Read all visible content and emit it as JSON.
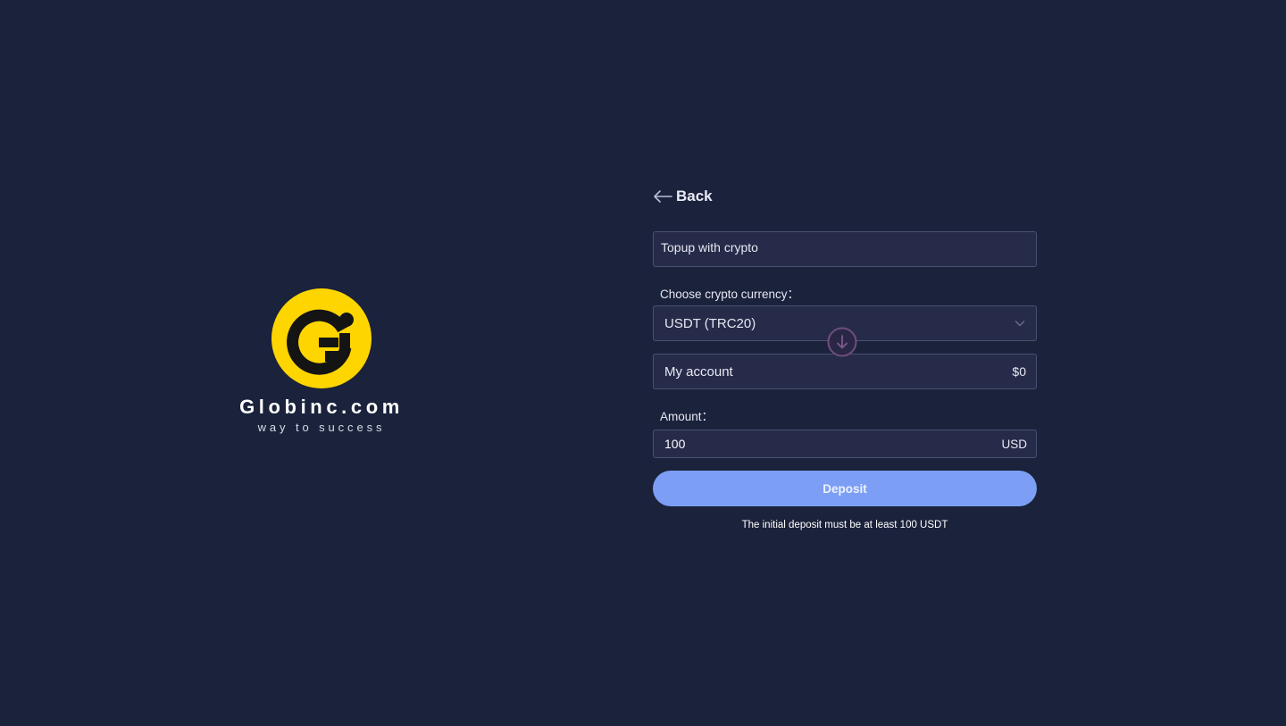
{
  "brand": {
    "name": "Globinc.com",
    "tagline": "way to success",
    "logo_color": "#ffd500"
  },
  "back": {
    "label": "Back",
    "icon": "arrow-left-icon"
  },
  "topup": {
    "method_label": "Topup with crypto",
    "currency_label": "Choose crypto currency：",
    "currency_value": "USDT (TRC20)",
    "swap_icon": "arrow-down-circle-icon",
    "account_label": "My account",
    "account_balance": "$0",
    "amount_label": "Amount：",
    "amount_value": "100",
    "amount_unit": "USD",
    "deposit_label": "Deposit",
    "note": "The initial deposit must be at least 100 USDT"
  },
  "colors": {
    "background": "#1b223b",
    "field_background": "#262b49",
    "accent": "#7c9ff5"
  }
}
